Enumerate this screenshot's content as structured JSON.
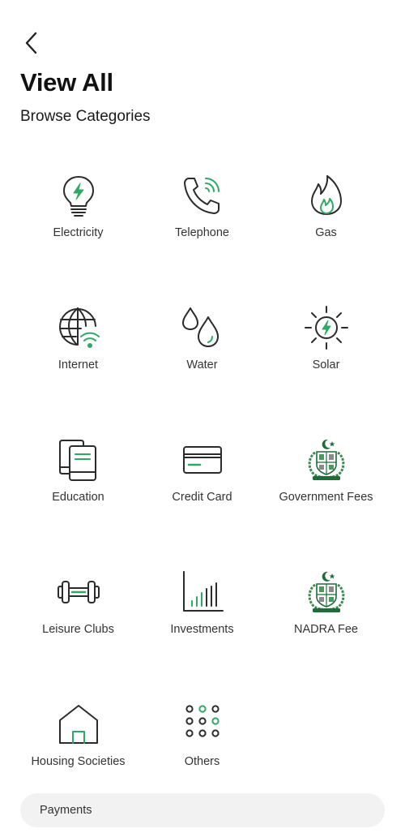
{
  "header": {
    "back_icon": "chevron-left-icon",
    "title": "View All",
    "subtitle": "Browse Categories"
  },
  "colors": {
    "accent": "#2fa866",
    "icon_stroke": "#2b2b2b",
    "emblem_green": "#1f6b3a"
  },
  "categories": [
    {
      "label": "Electricity",
      "icon": "lightbulb-bolt-icon"
    },
    {
      "label": "Telephone",
      "icon": "phone-signal-icon"
    },
    {
      "label": "Gas",
      "icon": "flame-icon"
    },
    {
      "label": "Internet",
      "icon": "globe-wifi-icon"
    },
    {
      "label": "Water",
      "icon": "water-drops-icon"
    },
    {
      "label": "Solar",
      "icon": "sun-bolt-icon"
    },
    {
      "label": "Education",
      "icon": "books-icon"
    },
    {
      "label": "Credit Card",
      "icon": "credit-card-icon"
    },
    {
      "label": "Government Fees",
      "icon": "pakistan-emblem-icon"
    },
    {
      "label": "Leisure Clubs",
      "icon": "dumbbell-icon"
    },
    {
      "label": "Investments",
      "icon": "bar-chart-icon"
    },
    {
      "label": "NADRA Fee",
      "icon": "pakistan-emblem-icon"
    },
    {
      "label": "Housing Societies",
      "icon": "house-icon"
    },
    {
      "label": "Others",
      "icon": "dots-grid-icon"
    }
  ],
  "footer": {
    "payments_label": "Payments"
  }
}
